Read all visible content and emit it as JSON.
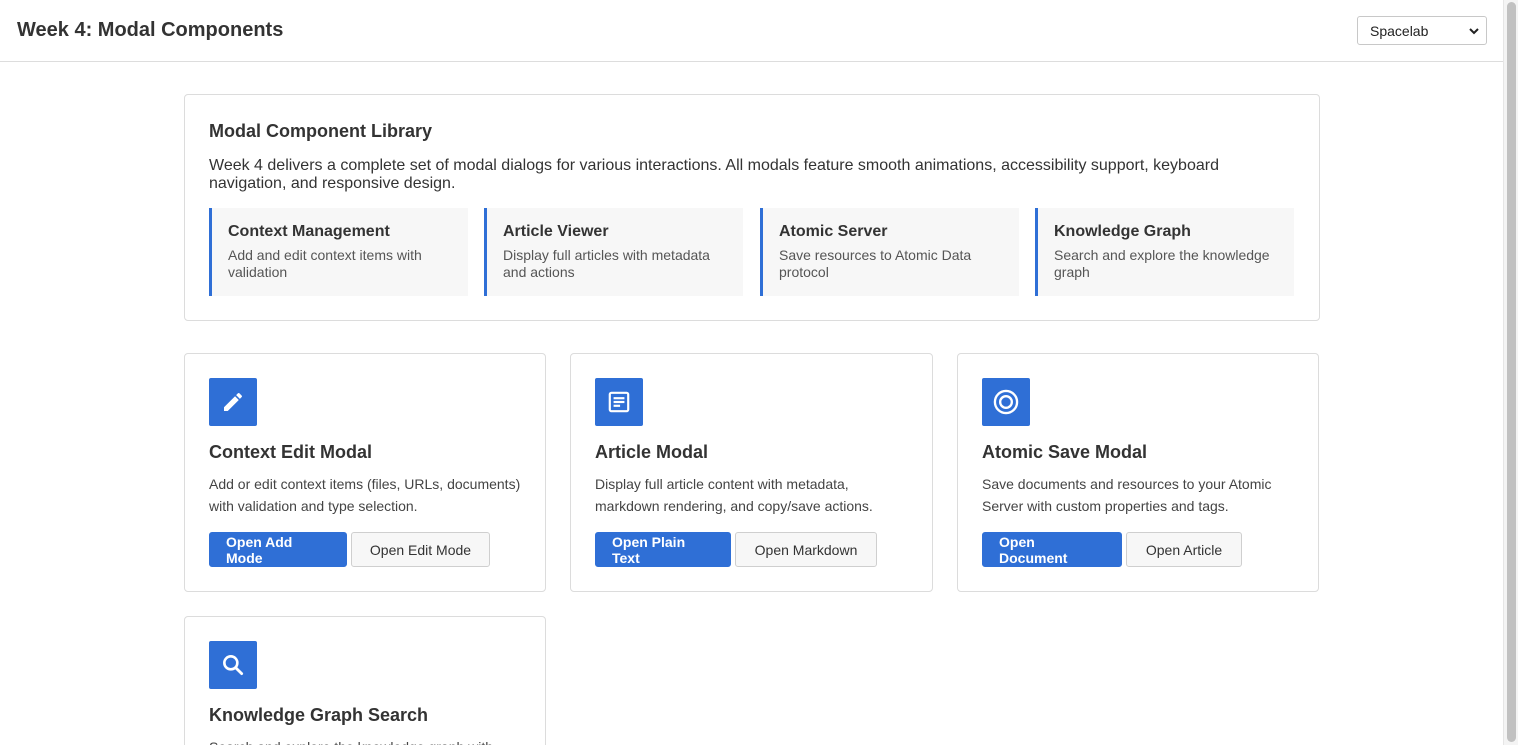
{
  "header": {
    "title": "Week 4: Modal Components",
    "theme_select": {
      "value": "Spacelab"
    }
  },
  "library": {
    "title": "Modal Component Library",
    "description": "Week 4 delivers a complete set of modal dialogs for various interactions. All modals feature smooth animations, accessibility support, keyboard navigation, and responsive design.",
    "features": [
      {
        "title": "Context Management",
        "desc": "Add and edit context items with validation"
      },
      {
        "title": "Article Viewer",
        "desc": "Display full articles with metadata and actions"
      },
      {
        "title": "Atomic Server",
        "desc": "Save resources to Atomic Data protocol"
      },
      {
        "title": "Knowledge Graph",
        "desc": "Search and explore the knowledge graph"
      }
    ]
  },
  "cards": [
    {
      "icon": "pencil-icon",
      "title": "Context Edit Modal",
      "desc": "Add or edit context items (files, URLs, documents) with validation and type selection.",
      "primary": "Open Add Mode",
      "secondary": "Open Edit Mode"
    },
    {
      "icon": "article-icon",
      "title": "Article Modal",
      "desc": "Display full article content with metadata, markdown rendering, and copy/save actions.",
      "primary": "Open Plain Text",
      "secondary": "Open Markdown"
    },
    {
      "icon": "atomic-ring-icon",
      "title": "Atomic Save Modal",
      "desc": "Save documents and resources to your Atomic Server with custom properties and tags.",
      "primary": "Open Document",
      "secondary": "Open Article"
    },
    {
      "icon": "search-icon",
      "title": "Knowledge Graph Search",
      "desc": "Search and explore the knowledge graph with"
    }
  ],
  "colors": {
    "accent": "#2f6fd6",
    "text": "#333333",
    "border": "#dcdcdc"
  }
}
